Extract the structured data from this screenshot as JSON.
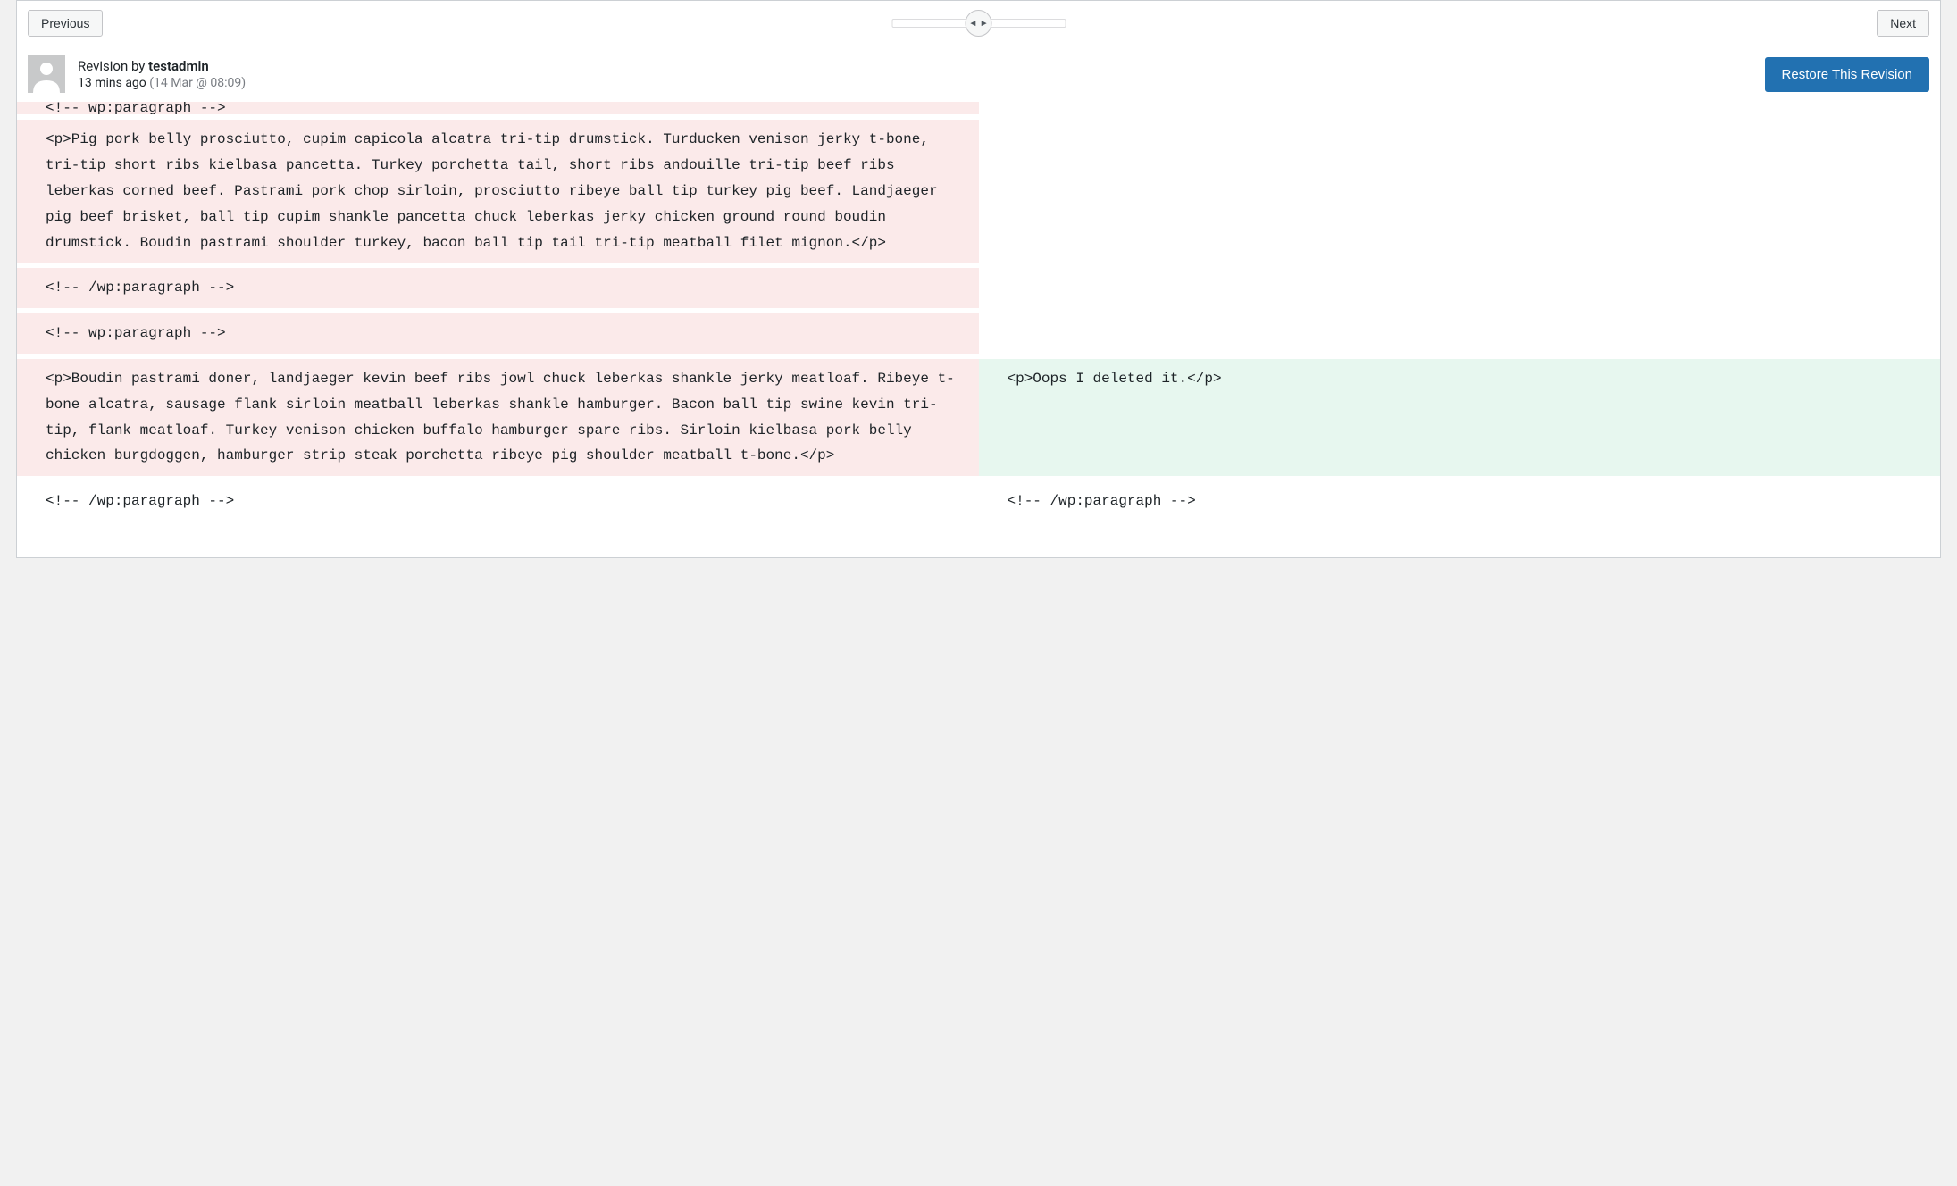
{
  "navigation": {
    "previous_label": "Previous",
    "next_label": "Next",
    "slider_handle": "◄ ►"
  },
  "revision": {
    "by_prefix": "Revision by ",
    "username": "testadmin",
    "time_relative": "13 mins ago",
    "time_absolute": " (14 Mar @ 08:09)",
    "restore_label": "Restore This Revision"
  },
  "diff": {
    "rows": [
      {
        "type": "deleted",
        "left": "<!-- wp:paragraph -->",
        "right": "",
        "partial": true
      },
      {
        "type": "deleted",
        "left": "<p>Pig pork belly prosciutto, cupim capicola alcatra tri-tip drumstick. Turducken venison jerky t-bone, tri-tip short ribs kielbasa pancetta. Turkey porchetta tail, short ribs andouille tri-tip beef ribs leberkas corned beef. Pastrami pork chop sirloin, prosciutto ribeye ball tip turkey pig beef. Landjaeger pig beef brisket, ball tip cupim shankle pancetta chuck leberkas jerky chicken ground round boudin drumstick. Boudin pastrami shoulder turkey, bacon ball tip tail tri-tip meatball filet mignon.</p>",
        "right": ""
      },
      {
        "type": "deleted",
        "left": "<!-- /wp:paragraph -->",
        "right": ""
      },
      {
        "type": "deleted",
        "left": "<!-- wp:paragraph -->",
        "right": ""
      },
      {
        "type": "changed",
        "left": "<p>Boudin pastrami doner, landjaeger kevin beef ribs jowl chuck leberkas shankle jerky meatloaf. Ribeye t-bone alcatra, sausage flank sirloin meatball leberkas shankle hamburger. Bacon ball tip swine kevin tri-tip, flank meatloaf. Turkey venison chicken buffalo hamburger spare ribs. Sirloin kielbasa pork belly chicken burgdoggen, hamburger strip steak porchetta ribeye pig shoulder meatball t-bone.</p>",
        "right": "<p>Oops I deleted it.</p>"
      },
      {
        "type": "context",
        "left": "<!-- /wp:paragraph -->",
        "right": "<!-- /wp:paragraph -->"
      }
    ]
  }
}
